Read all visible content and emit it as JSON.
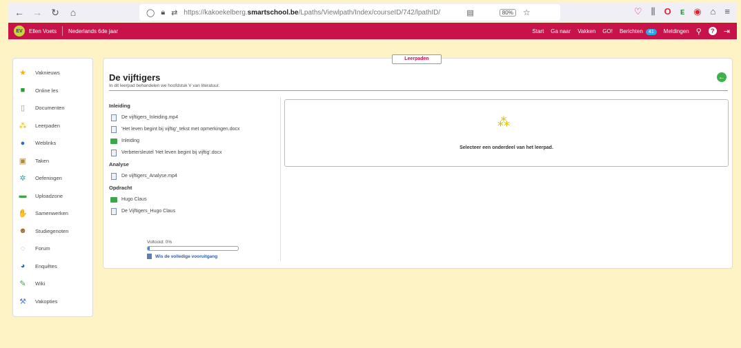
{
  "browser": {
    "url_prefix": "https://kakoekelberg.",
    "url_domain": "smartschool.be",
    "url_path": "/Lpaths/Viewlpath/Index/courseID/742/lpathID/",
    "zoom": "80%"
  },
  "topbar": {
    "avatar_initials": "EV",
    "user_name": "Ellen Voets",
    "course": "Nederlands 6de jaar",
    "nav": {
      "start": "Start",
      "ganaar": "Ga naar",
      "vakken": "Vakken",
      "go": "GO!",
      "berichten": "Berichten",
      "berichten_count": "41",
      "meldingen": "Meldingen"
    }
  },
  "sidebar": {
    "items": [
      {
        "label": "Vaknieuws"
      },
      {
        "label": "Online les"
      },
      {
        "label": "Documenten"
      },
      {
        "label": "Leerpaden"
      },
      {
        "label": "Weblinks"
      },
      {
        "label": "Taken"
      },
      {
        "label": "Oefeningen"
      },
      {
        "label": "Uploadzone"
      },
      {
        "label": "Samenwerken"
      },
      {
        "label": "Studiegenoten"
      },
      {
        "label": "Forum"
      },
      {
        "label": "Enquêtes"
      },
      {
        "label": "Wiki"
      },
      {
        "label": "Vakopties"
      }
    ]
  },
  "main": {
    "tab": "Leerpaden",
    "title": "De vijftigers",
    "subtitle": "In dit leerpad behandelen we hoofdstuk V van literatuur.",
    "sections": [
      {
        "heading": "Inleiding",
        "items": [
          {
            "label": "De vijftigers_Inleiding.mp4"
          },
          {
            "label": "'Het leven begint bij vijftig'_tekst met opmerkingen.docx"
          },
          {
            "label": "Inleiding"
          },
          {
            "label": "Verbetersleutel 'Het leven begint bij vijftig'.docx"
          }
        ]
      },
      {
        "heading": "Analyse",
        "items": [
          {
            "label": "De vijftigers_Analyse.mp4"
          }
        ]
      },
      {
        "heading": "Opdracht",
        "items": [
          {
            "label": "Hugo Claus"
          },
          {
            "label": "De Vijftigers_Hugo Claus"
          }
        ]
      }
    ],
    "progress_label": "Voltooid: 0%",
    "progress_fraction": 0.0,
    "reset_label": "Wis de volledige vooruitgang",
    "placeholder_message": "Selecteer een onderdeel van het leerpad."
  },
  "colors": {
    "brand": "#c8134a",
    "background": "#fdf3c4",
    "accent_green": "#3cb34a"
  }
}
